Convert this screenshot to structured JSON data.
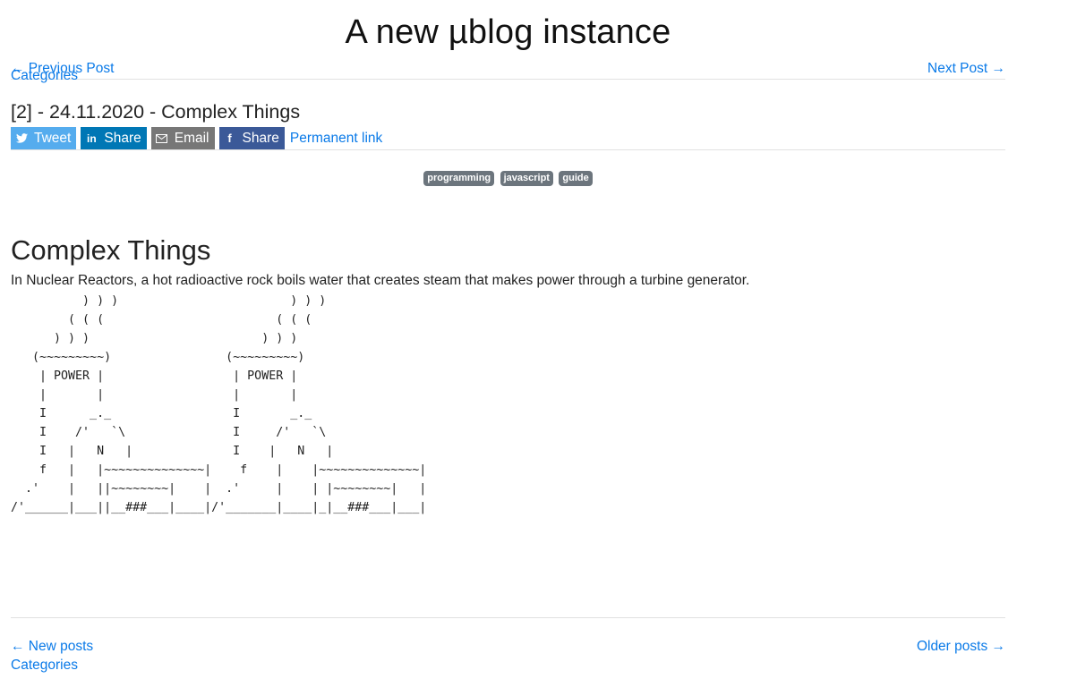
{
  "header": {
    "site_title": "A new µblog instance"
  },
  "top_nav": {
    "previous": "← Previous Post",
    "categories": "Categories",
    "next": "Next Post →"
  },
  "post": {
    "title": "[2] - 24.11.2020 - Complex Things",
    "share": {
      "tweet": "Tweet",
      "linkedin": "Share",
      "email": "Email",
      "facebook": "Share",
      "permalink": "Permanent link"
    },
    "icons": {
      "tweet": "twitter-icon",
      "linkedin": "linkedin-icon",
      "email": "envelope-icon",
      "facebook": "facebook-icon"
    },
    "tags": [
      "programming",
      "javascript",
      "guide"
    ],
    "heading": "Complex Things",
    "paragraph": "In Nuclear Reactors, a hot radioactive rock boils water that creates steam that makes power through a turbine generator.",
    "ascii_art": "          ) ) )                        ) ) )\n        ( ( (                        ( ( (\n      ) ) )                        ) ) )\n   (~~~~~~~~~)                (~~~~~~~~~)\n    | POWER |                  | POWER |\n    |       |                  |       |\n    I      _._                 I       _._\n    I    /'   `\\               I     /'   `\\\n    I   |   N   |              I    |   N   |\n    f   |   |~~~~~~~~~~~~~~|    f    |    |~~~~~~~~~~~~~~|\n  .'    |   ||~~~~~~~~|    |  .'     |    | |~~~~~~~~|   |\n/'______|___||__###___|____|/'_______|____|_|__###___|___|"
  },
  "bottom_nav": {
    "newer": "← New posts",
    "categories": "Categories",
    "older": "Older posts →"
  }
}
